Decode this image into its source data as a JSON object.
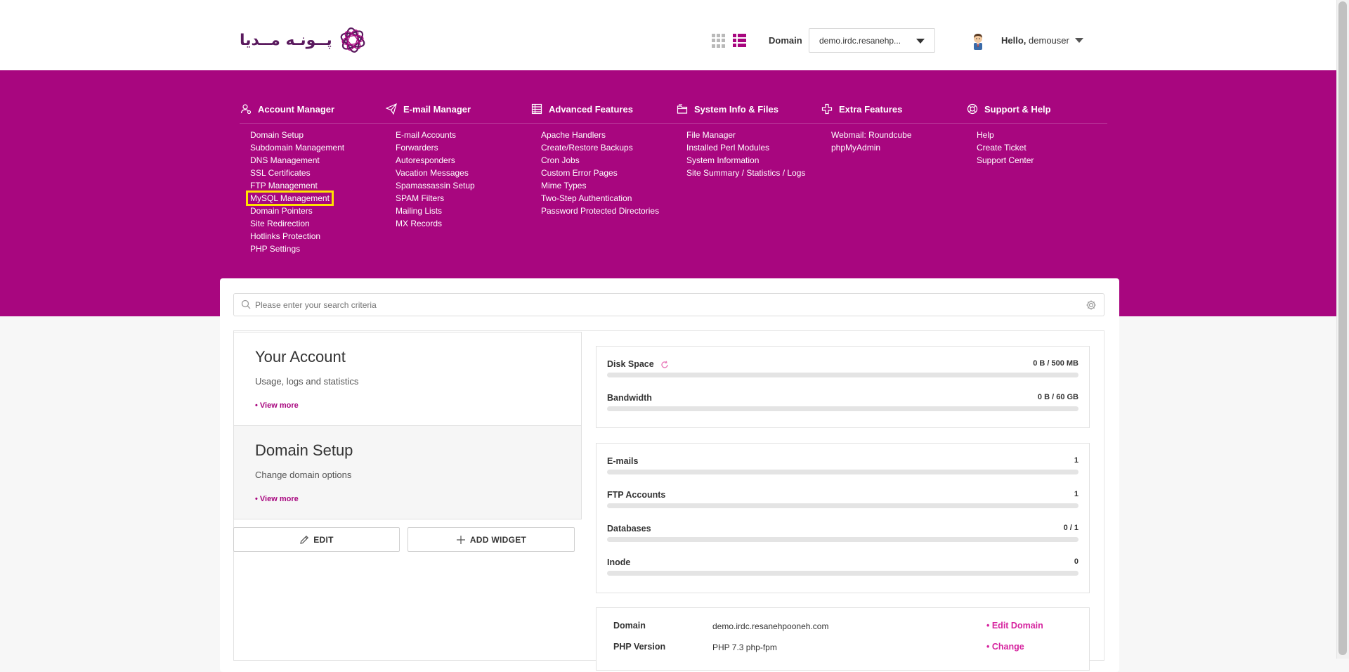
{
  "header": {
    "logo_text": "پــونـه مــدیا",
    "domain_label": "Domain",
    "domain_value": "demo.irdc.resanehp...",
    "greeting_prefix": "Hello,",
    "username": "demouser"
  },
  "menu": [
    {
      "heading": "Account Manager",
      "icon": "account-icon",
      "items": [
        "Domain Setup",
        "Subdomain Management",
        "DNS Management",
        "SSL Certificates",
        "FTP Management",
        "MySQL Management",
        "Domain Pointers",
        "Site Redirection",
        "Hotlinks Protection",
        "PHP Settings"
      ]
    },
    {
      "heading": "E-mail Manager",
      "icon": "paper-plane-icon",
      "items": [
        "E-mail Accounts",
        "Forwarders",
        "Autoresponders",
        "Vacation Messages",
        "Spamassassin Setup",
        "SPAM Filters",
        "Mailing Lists",
        "MX Records"
      ]
    },
    {
      "heading": "Advanced Features",
      "icon": "table-icon",
      "items": [
        "Apache Handlers",
        "Create/Restore Backups",
        "Cron Jobs",
        "Custom Error Pages",
        "Mime Types",
        "Two-Step Authentication",
        "Password Protected Directories"
      ]
    },
    {
      "heading": "System Info & Files",
      "icon": "folder-icon",
      "items": [
        "File Manager",
        "Installed Perl Modules",
        "System Information",
        "Site Summary / Statistics / Logs"
      ]
    },
    {
      "heading": "Extra Features",
      "icon": "plus-icon",
      "items": [
        "Webmail: Roundcube",
        "phpMyAdmin"
      ]
    },
    {
      "heading": "Support & Help",
      "icon": "lifebuoy-icon",
      "items": [
        "Help",
        "Create Ticket",
        "Support Center"
      ]
    }
  ],
  "search": {
    "placeholder": "Please enter your search criteria"
  },
  "cards": [
    {
      "title": "Your Account",
      "desc": "Usage, logs and statistics",
      "more": "• View more"
    },
    {
      "title": "Domain Setup",
      "desc": "Change domain options",
      "more": "• View more"
    }
  ],
  "buttons": {
    "edit": "EDIT",
    "add_widget": "ADD WIDGET"
  },
  "usage": {
    "disk": {
      "label": "Disk Space",
      "value": "0 B / 500 MB",
      "fraction": 0
    },
    "bandwidth": {
      "label": "Bandwidth",
      "value": "0 B / 60 GB",
      "fraction": 0
    }
  },
  "counts": [
    {
      "label": "E-mails",
      "value": "1",
      "fraction": 0
    },
    {
      "label": "FTP Accounts",
      "value": "1",
      "fraction": 0
    },
    {
      "label": "Databases",
      "value": "0 / 1",
      "fraction": 0
    },
    {
      "label": "Inode",
      "value": "0",
      "fraction": 0
    }
  ],
  "info": [
    {
      "label": "Domain",
      "value": "demo.irdc.resanehpooneh.com",
      "link": "• Edit Domain"
    },
    {
      "label": "PHP Version",
      "value": "PHP 7.3 php-fpm",
      "link": "• Change"
    }
  ],
  "colors": {
    "brand": "#a8067f",
    "link": "#d6249f",
    "highlight": "#ffe100"
  }
}
